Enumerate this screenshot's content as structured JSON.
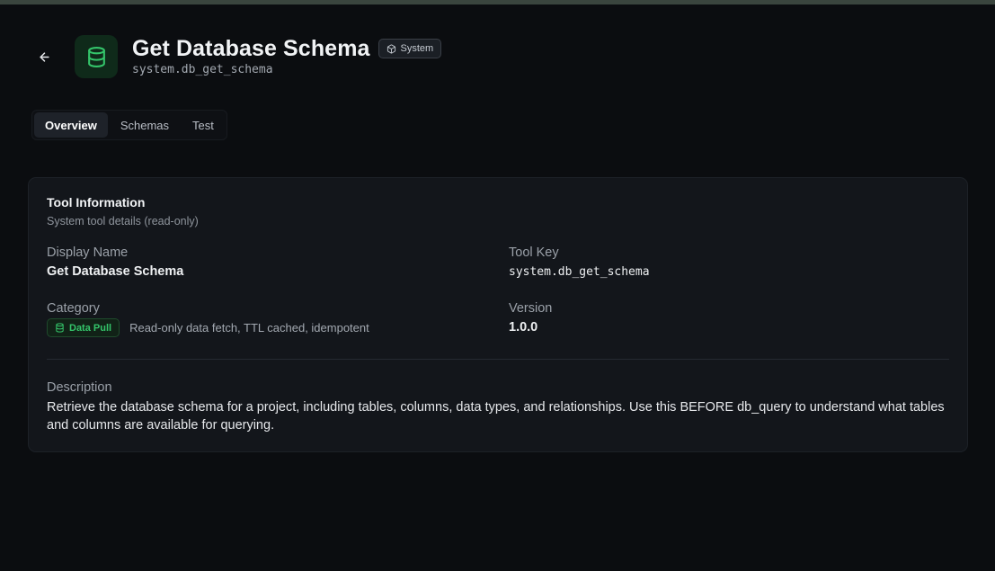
{
  "header": {
    "title": "Get Database Schema",
    "badge_label": "System",
    "tool_key": "system.db_get_schema"
  },
  "tabs": [
    {
      "label": "Overview",
      "active": true
    },
    {
      "label": "Schemas",
      "active": false
    },
    {
      "label": "Test",
      "active": false
    }
  ],
  "card": {
    "title": "Tool Information",
    "subtitle": "System tool details (read-only)",
    "display_name_label": "Display Name",
    "display_name_value": "Get Database Schema",
    "tool_key_label": "Tool Key",
    "tool_key_value": "system.db_get_schema",
    "category_label": "Category",
    "category_badge": "Data Pull",
    "category_description": "Read-only data fetch, TTL cached, idempotent",
    "version_label": "Version",
    "version_value": "1.0.0",
    "description_label": "Description",
    "description_value": "Retrieve the database schema for a project, including tables, columns, data types, and relationships. Use this BEFORE db_query to understand what tables and columns are available for querying."
  },
  "icons": {
    "back": "arrow-left-icon",
    "tool": "database-icon",
    "system_badge": "package-icon",
    "category": "database-icon"
  },
  "colors": {
    "background": "#0b0d10",
    "card": "#13161b",
    "accent_green": "#34c46a",
    "tool_icon_bg": "#0f2a1a"
  }
}
